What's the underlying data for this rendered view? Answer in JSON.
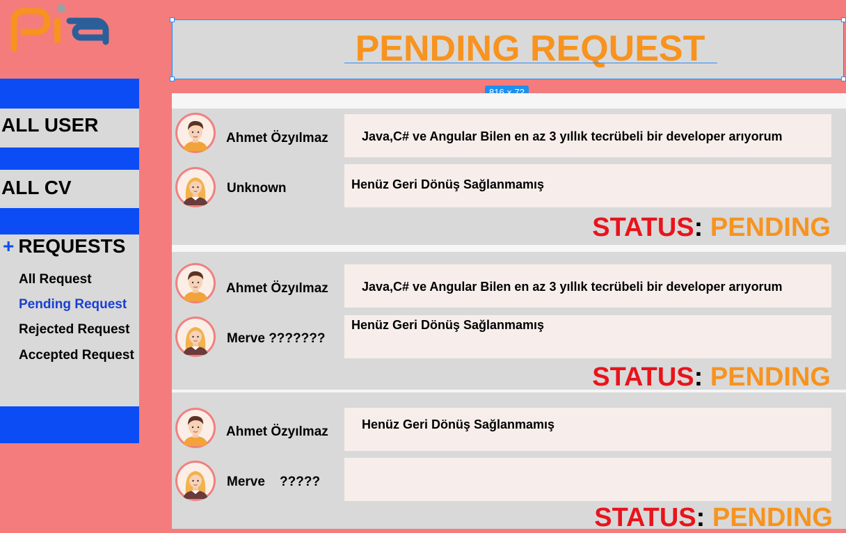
{
  "app": {
    "logo_text": "pia"
  },
  "colors": {
    "accent": "#f7931e",
    "brand_blue": "#0b4cf5",
    "status_red": "#e8141b",
    "background": "#f47c7c"
  },
  "page": {
    "title": "PENDING REQUEST",
    "selection_size": "816 × 72"
  },
  "sidebar": {
    "all_user": "ALL USER",
    "all_cv": "ALL CV",
    "requests_plus": "+",
    "requests": "REQUESTS",
    "items": [
      {
        "label": "All Request"
      },
      {
        "label": "Pending Request"
      },
      {
        "label": "Rejected Request"
      },
      {
        "label": "Accepted Request"
      }
    ]
  },
  "requests": [
    {
      "requester": {
        "name": "Ahmet Özyılmaz",
        "avatar": "male-avatar-icon",
        "message": "Java,C# ve Angular Bilen en az 3 yıllık tecrübeli bir developer arıyorum"
      },
      "responder": {
        "name": "Unknown",
        "avatar": "female-avatar-icon",
        "message": "Henüz Geri Dönüş Sağlanmamış"
      },
      "status_label": "STATUS",
      "status_colon": ":",
      "status_value": "PENDING"
    },
    {
      "requester": {
        "name": "Ahmet Özyılmaz",
        "avatar": "male-avatar-icon",
        "message": "Java,C# ve Angular Bilen en az 3 yıllık tecrübeli bir developer arıyorum"
      },
      "responder": {
        "name": "Merve ???????",
        "avatar": "female-avatar-icon",
        "message": "Henüz Geri Dönüş Sağlanmamış"
      },
      "status_label": "STATUS",
      "status_colon": ":",
      "status_value": "PENDING"
    },
    {
      "requester": {
        "name": "Ahmet Özyılmaz",
        "avatar": "male-avatar-icon",
        "message": "Henüz Geri Dönüş Sağlanmamış"
      },
      "responder": {
        "name": "Merve    ?????",
        "avatar": "female-avatar-icon",
        "message": ""
      },
      "status_label": "STATUS",
      "status_colon": ":",
      "status_value": "PENDING"
    }
  ]
}
